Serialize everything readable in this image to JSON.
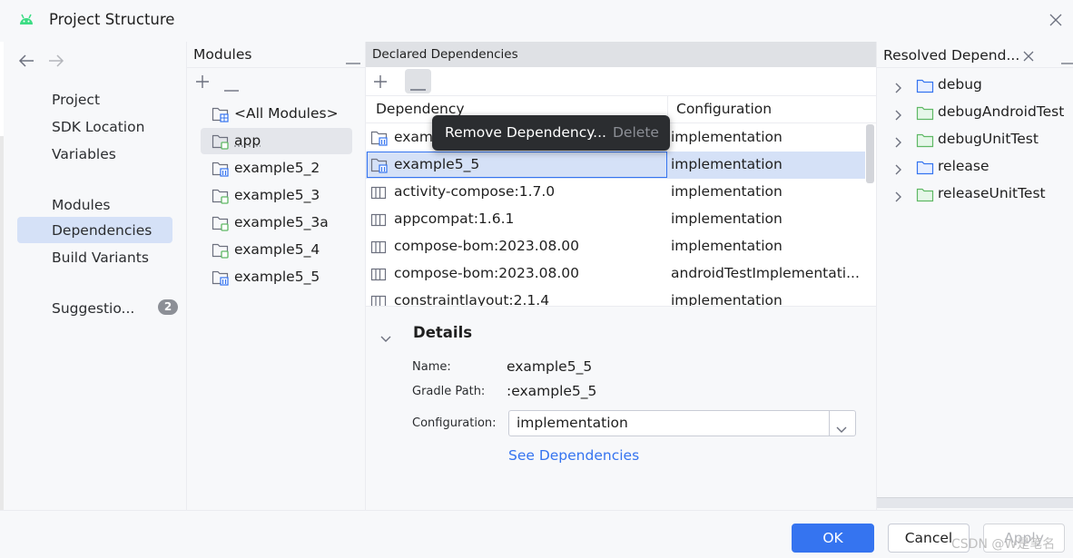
{
  "window": {
    "title": "Project Structure"
  },
  "nav": {
    "group1": [
      "Project",
      "SDK Location",
      "Variables"
    ],
    "group2": [
      "Modules",
      "Dependencies",
      "Build Variants"
    ],
    "suggestions_label": "Suggestio...",
    "suggestions_count": "2",
    "selected": "Dependencies"
  },
  "modules": {
    "title": "Modules",
    "items": [
      "<All Modules>",
      "app",
      "example5_2",
      "example5_3",
      "example5_3a",
      "example5_4",
      "example5_5"
    ],
    "selected": "app"
  },
  "declared": {
    "title": "Declared Dependencies",
    "col_dependency": "Dependency",
    "col_configuration": "Configuration",
    "rows": [
      {
        "dep": "exam",
        "cfg": "implementation",
        "kind": "module"
      },
      {
        "dep": "example5_5",
        "cfg": "implementation",
        "kind": "module"
      },
      {
        "dep": "activity-compose:1.7.0",
        "cfg": "implementation",
        "kind": "library"
      },
      {
        "dep": "appcompat:1.6.1",
        "cfg": "implementation",
        "kind": "library"
      },
      {
        "dep": "compose-bom:2023.08.00",
        "cfg": "implementation",
        "kind": "library"
      },
      {
        "dep": "compose-bom:2023.08.00",
        "cfg": "androidTestImplementati...",
        "kind": "library"
      },
      {
        "dep": "constraintlayout:2.1.4",
        "cfg": "implementation",
        "kind": "library"
      }
    ],
    "selected_row": 1
  },
  "popup": {
    "item": "Remove Dependency...",
    "shortcut": "Delete"
  },
  "details": {
    "title": "Details",
    "name_label": "Name:",
    "name_value": "example5_5",
    "gradle_label": "Gradle Path:",
    "gradle_value": ":example5_5",
    "config_label": "Configuration:",
    "config_value": "implementation",
    "see_deps": "See Dependencies"
  },
  "resolved": {
    "title": "Resolved Depend...",
    "items": [
      "debug",
      "debugAndroidTest",
      "debugUnitTest",
      "release",
      "releaseUnitTest"
    ]
  },
  "buttons": {
    "ok": "OK",
    "cancel": "Cancel",
    "apply": "Apply"
  },
  "watermark": "CSDN @W是笔名",
  "colors": {
    "accent": "#3574f0",
    "selection": "#d5e1f7",
    "folder_blue": "#3574f0",
    "folder_green": "#5fb865"
  }
}
